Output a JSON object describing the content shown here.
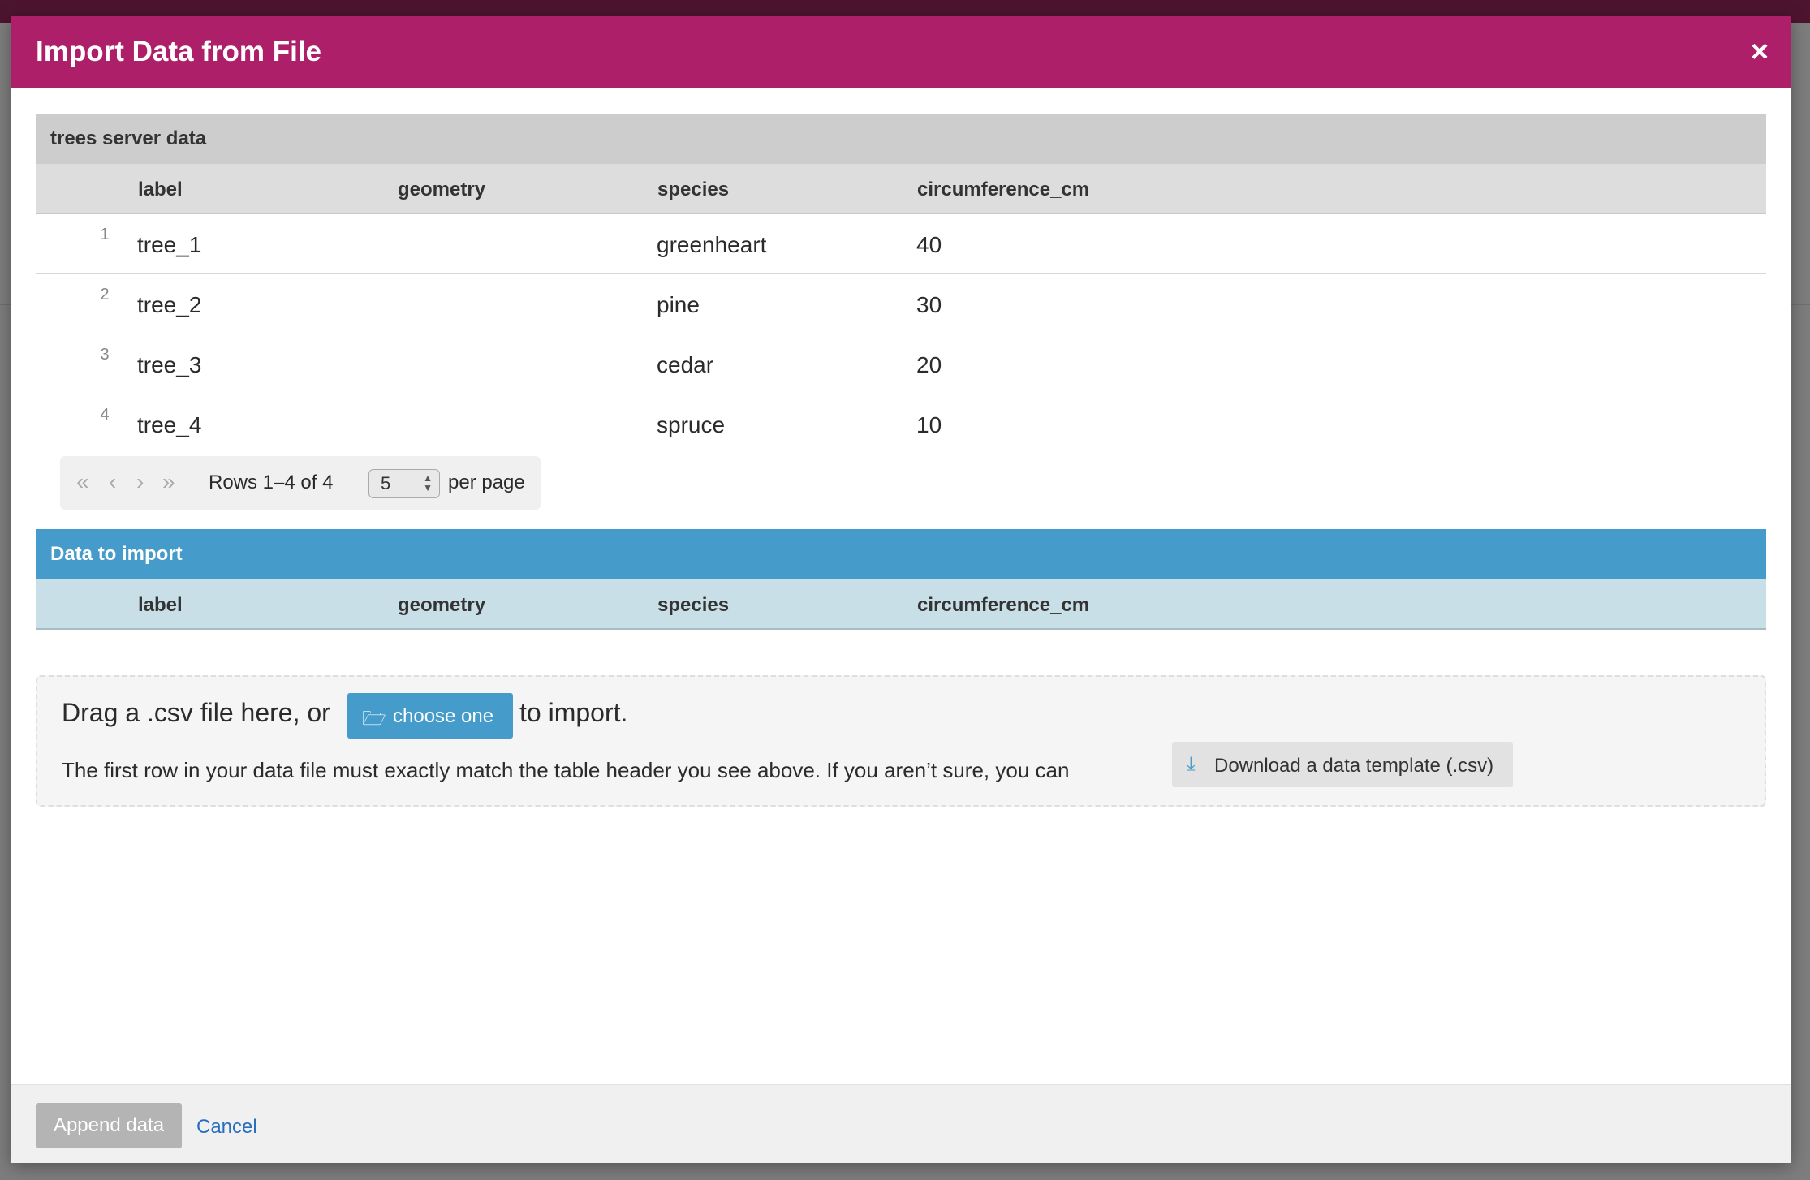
{
  "modal": {
    "title": "Import Data from File",
    "close_icon": "×"
  },
  "server_table": {
    "title": "trees server data",
    "columns": [
      "label",
      "geometry",
      "species",
      "circumference_cm"
    ],
    "rows": [
      {
        "index": "1",
        "label": "tree_1",
        "geometry": "",
        "species": "greenheart",
        "circumference_cm": "40"
      },
      {
        "index": "2",
        "label": "tree_2",
        "geometry": "",
        "species": "pine",
        "circumference_cm": "30"
      },
      {
        "index": "3",
        "label": "tree_3",
        "geometry": "",
        "species": "cedar",
        "circumference_cm": "20"
      },
      {
        "index": "4",
        "label": "tree_4",
        "geometry": "",
        "species": "spruce",
        "circumference_cm": "10"
      }
    ]
  },
  "pager": {
    "first_icon": "«",
    "prev_icon": "‹",
    "next_icon": "›",
    "last_icon": "»",
    "rows_text": "Rows 1–4 of 4",
    "per_page_value": "5",
    "per_page_label": "per page"
  },
  "import_table": {
    "title": "Data to import",
    "columns": [
      "label",
      "geometry",
      "species",
      "circumference_cm"
    ]
  },
  "dropzone": {
    "text_before": "Drag a .csv file here, or",
    "choose_button": "choose one",
    "text_after": "to import.",
    "help_text": "The first row in your data file must exactly match the table header you see above. If you aren’t sure, you can",
    "template_button": "Download a data template (.csv)"
  },
  "footer": {
    "append_button": "Append data",
    "cancel_link": "Cancel"
  },
  "colors": {
    "header": "#ad1f69",
    "accent": "#459bc9"
  },
  "icons": {
    "close": "close-icon",
    "folder": "folder-open-icon",
    "download": "download-icon"
  }
}
